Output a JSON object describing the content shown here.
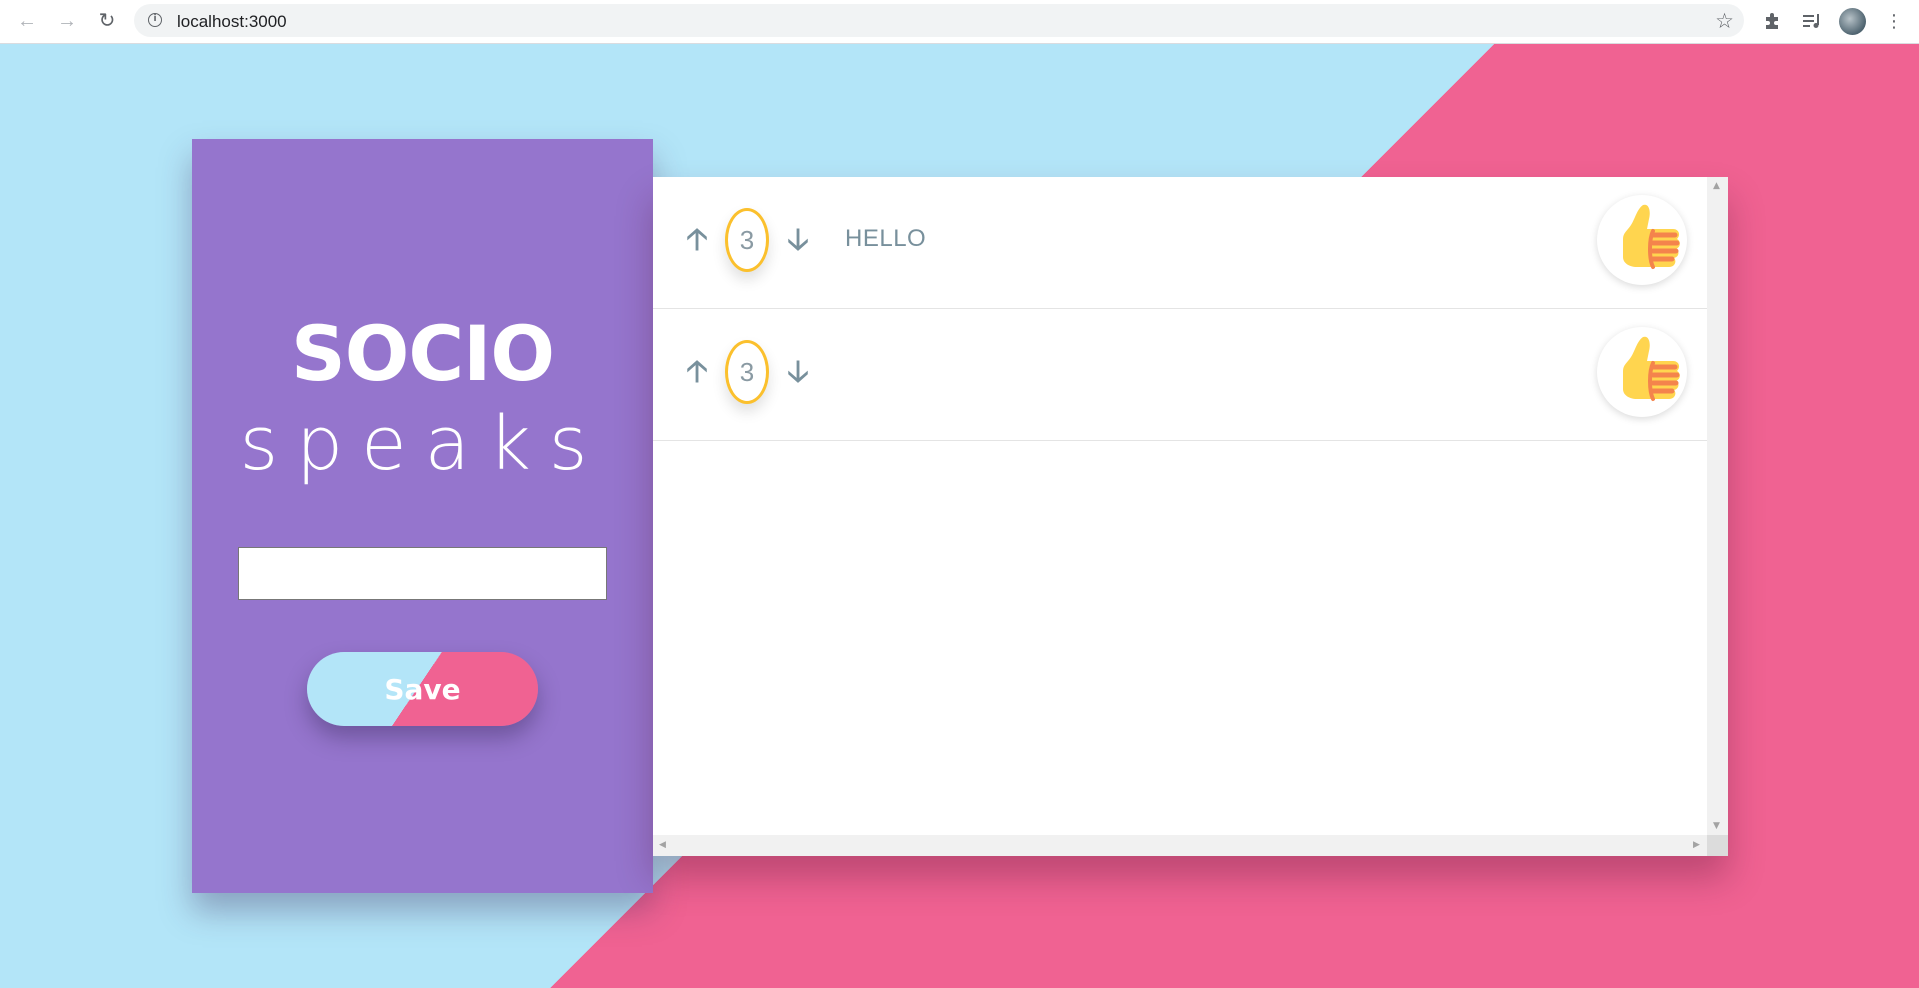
{
  "browser": {
    "url": "localhost:3000"
  },
  "app": {
    "brand_title": "SOCIO",
    "brand_subtitle": "speaks",
    "input_value": "",
    "save_label": "Save",
    "colors": {
      "sky": "#b3e5f8",
      "pink": "#f06292",
      "purple": "#9575cd",
      "accent": "#fbc02d"
    }
  },
  "posts": [
    {
      "count": "3",
      "text": "HELLO"
    },
    {
      "count": "3",
      "text": ""
    }
  ],
  "icons": {
    "up": "arrow-up-icon",
    "down": "arrow-down-icon",
    "like": "thumbs-up-icon"
  }
}
